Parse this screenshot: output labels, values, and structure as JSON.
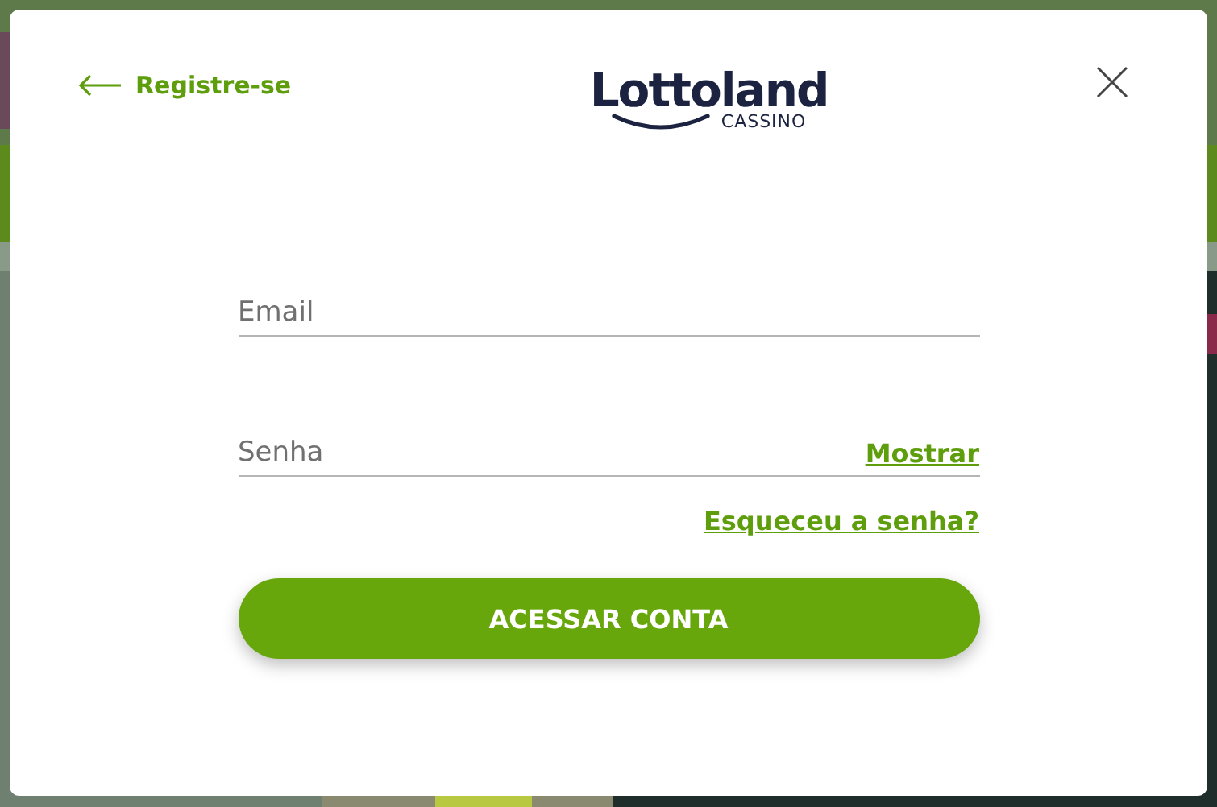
{
  "back_link": {
    "label": "Registre-se"
  },
  "logo": {
    "name": "Lottoland",
    "subtitle": "CASSINO"
  },
  "fields": [
    {
      "placeholder": "Email"
    },
    {
      "placeholder": "Senha",
      "toggle": "Mostrar"
    }
  ],
  "forgot_link": "Esqueceu a senha?",
  "submit": "ACESSAR CONTA"
}
